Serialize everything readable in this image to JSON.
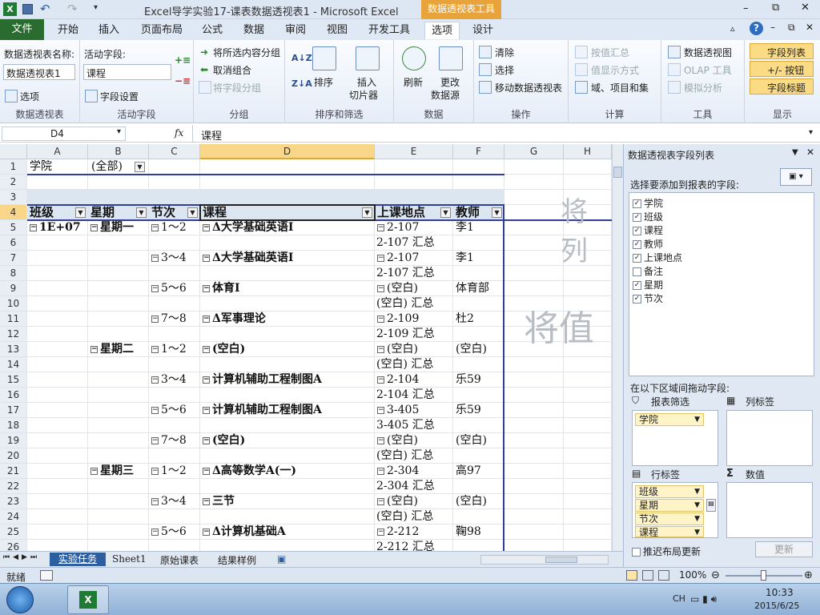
{
  "window": {
    "title": "Excel导学实验17-课表数据透视表1 - Microsoft Excel",
    "context_tab": "数据透视表工具",
    "win_buttons": [
      "–",
      "⧉",
      "✕"
    ]
  },
  "tabs": [
    "文件",
    "开始",
    "插入",
    "页面布局",
    "公式",
    "数据",
    "审阅",
    "视图",
    "开发工具",
    "选项",
    "设计"
  ],
  "ribbon": {
    "pivot": {
      "name_label": "数据透视表名称:",
      "name_value": "数据透视表1",
      "options": "选项",
      "group": "数据透视表"
    },
    "active": {
      "label": "活动字段:",
      "value": "课程",
      "settings": "字段设置",
      "group": "活动字段"
    },
    "grouping": {
      "items": [
        "将所选内容分组",
        "取消组合",
        "将字段分组"
      ],
      "group": "分组"
    },
    "sort": {
      "sort": "排序",
      "slicer1": "插入",
      "slicer2": "切片器",
      "group": "排序和筛选"
    },
    "data": {
      "refresh": "刷新",
      "change1": "更改",
      "change2": "数据源",
      "group": "数据"
    },
    "actions": {
      "items": [
        "清除",
        "选择",
        "移动数据透视表"
      ],
      "group": "操作"
    },
    "calc": {
      "items": [
        "按值汇总",
        "值显示方式",
        "域、项目和集"
      ],
      "group": "计算"
    },
    "tools": {
      "items": [
        "数据透视图",
        "OLAP 工具",
        "模拟分析"
      ],
      "group": "工具"
    },
    "show": {
      "items": [
        "字段列表",
        "+/- 按钮",
        "字段标题"
      ],
      "group": "显示"
    }
  },
  "formula_bar": {
    "name_box": "D4",
    "fx": "fx",
    "value": "课程"
  },
  "columns": [
    "A",
    "B",
    "C",
    "D",
    "E",
    "F",
    "G",
    "H"
  ],
  "rows": [
    "1",
    "2",
    "3",
    "4",
    "5",
    "6",
    "7",
    "8",
    "9",
    "10",
    "11",
    "12",
    "13",
    "14",
    "15",
    "16",
    "17",
    "18",
    "19",
    "20",
    "21",
    "22",
    "23",
    "24",
    "25",
    "26"
  ],
  "sheet": {
    "r1": {
      "a": "学院",
      "b": "(全部)"
    },
    "headers": [
      "班级",
      "星期",
      "节次",
      "课程",
      "上课地点",
      "教师"
    ],
    "watermark_col": "将列",
    "watermark_val": "将值",
    "data": [
      {
        "r": 5,
        "a": "1E+07",
        "b": "星期一",
        "c": "1～2",
        "d": "Δ大学基础英语Ⅰ",
        "e": "2-107",
        "f": "李1"
      },
      {
        "r": 6,
        "e": "2-107 汇总"
      },
      {
        "r": 7,
        "c": "3～4",
        "d": "Δ大学基础英语Ⅰ",
        "e": "2-107",
        "f": "李1"
      },
      {
        "r": 8,
        "e": "2-107 汇总"
      },
      {
        "r": 9,
        "c": "5～6",
        "d": "体育Ⅰ",
        "e": "(空白)",
        "f": "体育部"
      },
      {
        "r": 10,
        "e": "(空白) 汇总"
      },
      {
        "r": 11,
        "c": "7～8",
        "d": "Δ军事理论",
        "e": "2-109",
        "f": "杜2"
      },
      {
        "r": 12,
        "e": "2-109 汇总"
      },
      {
        "r": 13,
        "b": "星期二",
        "c": "1～2",
        "d": "(空白)",
        "e": "(空白)",
        "f": "(空白)"
      },
      {
        "r": 14,
        "e": "(空白) 汇总"
      },
      {
        "r": 15,
        "c": "3～4",
        "d": "计算机辅助工程制图A",
        "e": "2-104",
        "f": "乐59"
      },
      {
        "r": 16,
        "e": "2-104 汇总"
      },
      {
        "r": 17,
        "c": "5～6",
        "d": "计算机辅助工程制图A",
        "e": "3-405",
        "f": "乐59"
      },
      {
        "r": 18,
        "e": "3-405  汇总"
      },
      {
        "r": 19,
        "c": "7～8",
        "d": "(空白)",
        "e": "(空白)",
        "f": "(空白)"
      },
      {
        "r": 20,
        "e": "(空白) 汇总"
      },
      {
        "r": 21,
        "b": "星期三",
        "c": "1～2",
        "d": "Δ高等数学A(一)",
        "e": "2-304",
        "f": "高97"
      },
      {
        "r": 22,
        "e": "2-304 汇总"
      },
      {
        "r": 23,
        "c": "3～4",
        "d": "三节",
        "e": "(空白)",
        "f": "(空白)"
      },
      {
        "r": 24,
        "e": "(空白) 汇总"
      },
      {
        "r": 25,
        "c": "5～6",
        "d": "Δ计算机基础A",
        "e": "2-212",
        "f": "鞠98"
      },
      {
        "r": 26,
        "e": "2-212 汇总"
      }
    ]
  },
  "panel": {
    "title": "数据透视表字段列表",
    "choose": "选择要添加到报表的字段:",
    "fields": [
      {
        "name": "学院",
        "checked": true
      },
      {
        "name": "班级",
        "checked": true
      },
      {
        "name": "课程",
        "checked": true
      },
      {
        "name": "教师",
        "checked": true
      },
      {
        "name": "上课地点",
        "checked": true
      },
      {
        "name": "备注",
        "checked": false
      },
      {
        "name": "星期",
        "checked": true
      },
      {
        "name": "节次",
        "checked": true
      }
    ],
    "drag": "在以下区域间拖动字段:",
    "filter": "报表筛选",
    "col": "列标签",
    "row": "行标签",
    "val": "数值",
    "filter_items": [
      "学院"
    ],
    "row_items": [
      "班级",
      "星期",
      "节次",
      "课程"
    ],
    "defer": "推迟布局更新",
    "update": "更新"
  },
  "sheet_tabs": [
    "实验任务",
    "Sheet1",
    "原始课表",
    "结果样例"
  ],
  "status": {
    "ready": "就绪",
    "zoom": "100%"
  },
  "taskbar": {
    "lang": "CH",
    "time": "10:33",
    "date": "2015/6/25"
  }
}
